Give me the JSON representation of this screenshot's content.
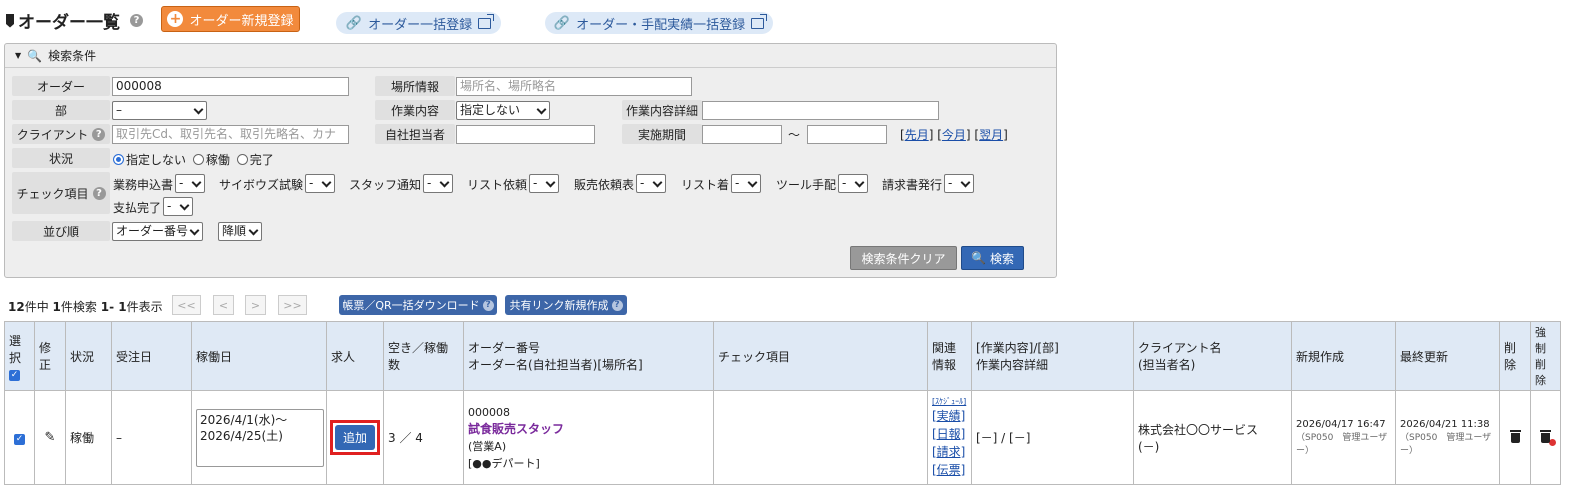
{
  "header": {
    "title": "オーダー一覧",
    "new_button": "オーダー新規登録",
    "bulk_register": "オーダー一括登録",
    "bulk_record": "オーダー・手配実績一括登録"
  },
  "search": {
    "panel_title": "検索条件",
    "order_label": "オーダー",
    "order_value": "000008",
    "dept_label": "部",
    "dept_value": "–",
    "client_label": "クライアント",
    "client_placeholder": "取引先Cd、取引先名、取引先略名、カナ",
    "status_label": "状況",
    "status_options": [
      "指定しない",
      "稼働",
      "完了"
    ],
    "check_label": "チェック項目",
    "sort_label": "並び順",
    "sort_value": "オーダー番号",
    "sort_dir": "降順",
    "place_label": "場所情報",
    "place_placeholder": "場所名、場所略名",
    "work_label": "作業内容",
    "work_value": "指定しない",
    "staff_label": "自社担当者",
    "work_detail_label": "作業内容詳細",
    "period_label": "実施期間",
    "tilde": "〜",
    "prev_month": "先月",
    "this_month": "今月",
    "next_month": "翌月",
    "check_items": [
      {
        "label": "業務申込書",
        "value": "-"
      },
      {
        "label": "サイボウズ試験",
        "value": "-"
      },
      {
        "label": "スタッフ通知",
        "value": "-"
      },
      {
        "label": "リスト依頼",
        "value": "-"
      },
      {
        "label": "販売依頼表",
        "value": "-"
      },
      {
        "label": "リスト着",
        "value": "-"
      },
      {
        "label": "ツール手配",
        "value": "-"
      },
      {
        "label": "請求書発行",
        "value": "-"
      },
      {
        "label": "支払完了",
        "value": "-"
      }
    ],
    "clear_button": "検索条件クリア",
    "search_button": "検索"
  },
  "results": {
    "total": "12",
    "total_suffix": "件中",
    "hit": "1",
    "hit_suffix": "件検索",
    "range": "1- 1",
    "range_suffix": "件表示",
    "pager": [
      "<<",
      "<",
      ">",
      ">>"
    ],
    "download_button": "帳票／QR一括ダウンロード",
    "share_button": "共有リンク新規作成"
  },
  "table": {
    "headers": {
      "select": "選択",
      "edit": "修正",
      "status": "状況",
      "order_date": "受注日",
      "work_date": "稼働日",
      "recruit": "求人",
      "vacancy": "空き／稼働数",
      "order_no_1": "オーダー番号",
      "order_no_2": "オーダー名(自社担当者)[場所名]",
      "check": "チェック項目",
      "related_1": "関連",
      "related_2": "情報",
      "work_1": "[作業内容]/[部]",
      "work_2": "作業内容詳細",
      "client_1": "クライアント名",
      "client_2": "(担当者名)",
      "created": "新規作成",
      "updated": "最終更新",
      "delete": "削除",
      "force_1": "強制",
      "force_2": "削除"
    },
    "row": {
      "status": "稼働",
      "order_date": "–",
      "work_date_1": "2026/4/1(水)〜",
      "work_date_2": "2026/4/25(土)",
      "add_button": "追加",
      "vacancy": "3 ／ 4",
      "order_no": "000008",
      "order_name": "試食販売スタッフ",
      "staff": "(営業A)",
      "place": "[●●デパート]",
      "schedule": "[ｽｹｼﾞｭｰﾙ]",
      "links": [
        "[実績]",
        "[日報]",
        "[請求]",
        "[伝票]"
      ],
      "work": "[－] / [－]",
      "client": "株式会社〇〇サービス",
      "client_contact": "(－)",
      "created_date": "2026/04/17 16:47",
      "created_by": "（SP050　管理ユーザー）",
      "updated_date": "2026/04/21 11:38",
      "updated_by": "（SP050　管理ユーザー）"
    }
  }
}
